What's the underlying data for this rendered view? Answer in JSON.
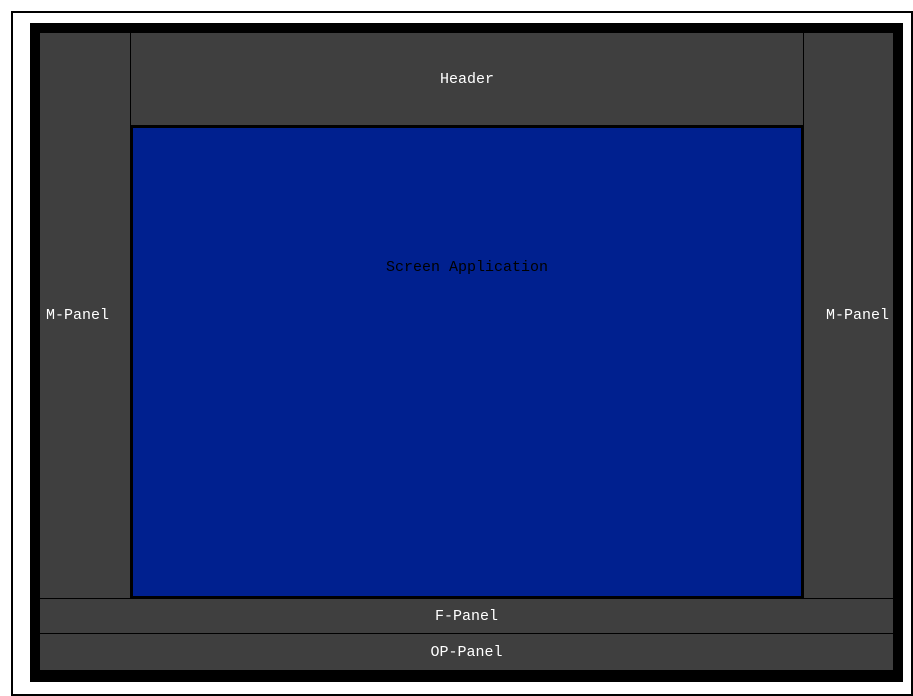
{
  "labels": {
    "header": "Header",
    "screen_application": "Screen Application",
    "m_panel_left": "M-Panel",
    "m_panel_right": "M-Panel",
    "f_panel": "F-Panel",
    "op_panel": "OP-Panel"
  },
  "colors": {
    "panel": "#3f3f3f",
    "screen_application": "#00208f",
    "frame": "#000000"
  }
}
